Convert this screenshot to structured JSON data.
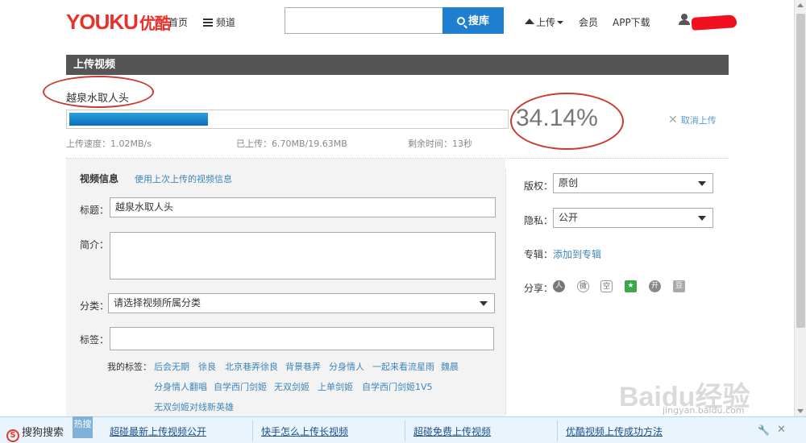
{
  "header": {
    "logo_text": "YOUKU",
    "logo_cn": "优酷",
    "nav_home": "首页",
    "nav_channel": "频道",
    "search_placeholder": "",
    "search_button": "搜库",
    "upload": "上传",
    "member": "会员",
    "app_download": "APP下载"
  },
  "upload": {
    "section_title": "上传视频",
    "file_name": "越泉水取人头",
    "percent_text": "34.14%",
    "progress_fraction": 0.3414,
    "cancel": "取消上传",
    "speed": "上传速度：1.02MB/s",
    "uploaded": "已上传：6.70MB/19.63MB",
    "remaining": "剩余时间：13秒"
  },
  "form": {
    "info_title": "视频信息",
    "use_last_link": "使用上次上传的视频信息",
    "title_label": "标题：",
    "title_value": "越泉水取人头",
    "intro_label": "简介：",
    "category_label": "分类：",
    "category_value": "请选择视频所属分类",
    "tags_label": "标签：",
    "my_tags_label": "我的标签：",
    "my_tags": [
      "后会无期",
      "徐良",
      "北京巷弄徐良",
      "背景巷弄",
      "分身情人",
      "一起来看流星雨",
      "魏晨",
      "分身情人翻唱",
      "自学西门剑姬",
      "无双剑姬",
      "上单剑姬",
      "自学西门剑姬1V5",
      "无双剑姬对线新英雄"
    ]
  },
  "side": {
    "copyright_label": "版权：",
    "copyright_value": "原创",
    "privacy_label": "隐私：",
    "privacy_value": "公开",
    "album_label": "专辑：",
    "album_link": "添加到专辑",
    "share_label": "分享：",
    "share_icons": [
      "renren-icon",
      "weibo-icon",
      "qzone-icon",
      "qq-star-icon",
      "kaixin-icon",
      "douban-icon"
    ]
  },
  "watermark": {
    "brand": "Baidu经验",
    "url": "jingyan.baidu.com"
  },
  "bottom_bar": {
    "brand": "搜狗搜索",
    "hot": "热搜",
    "links": [
      "超碰最新上传视频公开",
      "快手怎么上传长视频",
      "超碰免费上传视频",
      "优酷视频上传成功方法"
    ]
  },
  "colors": {
    "brand_red": "#e8312a",
    "search_blue": "#1e7ed0",
    "progress_blue": "#1a86cc",
    "annotation_red": "#c93a32",
    "link_blue": "#3d85b8"
  }
}
